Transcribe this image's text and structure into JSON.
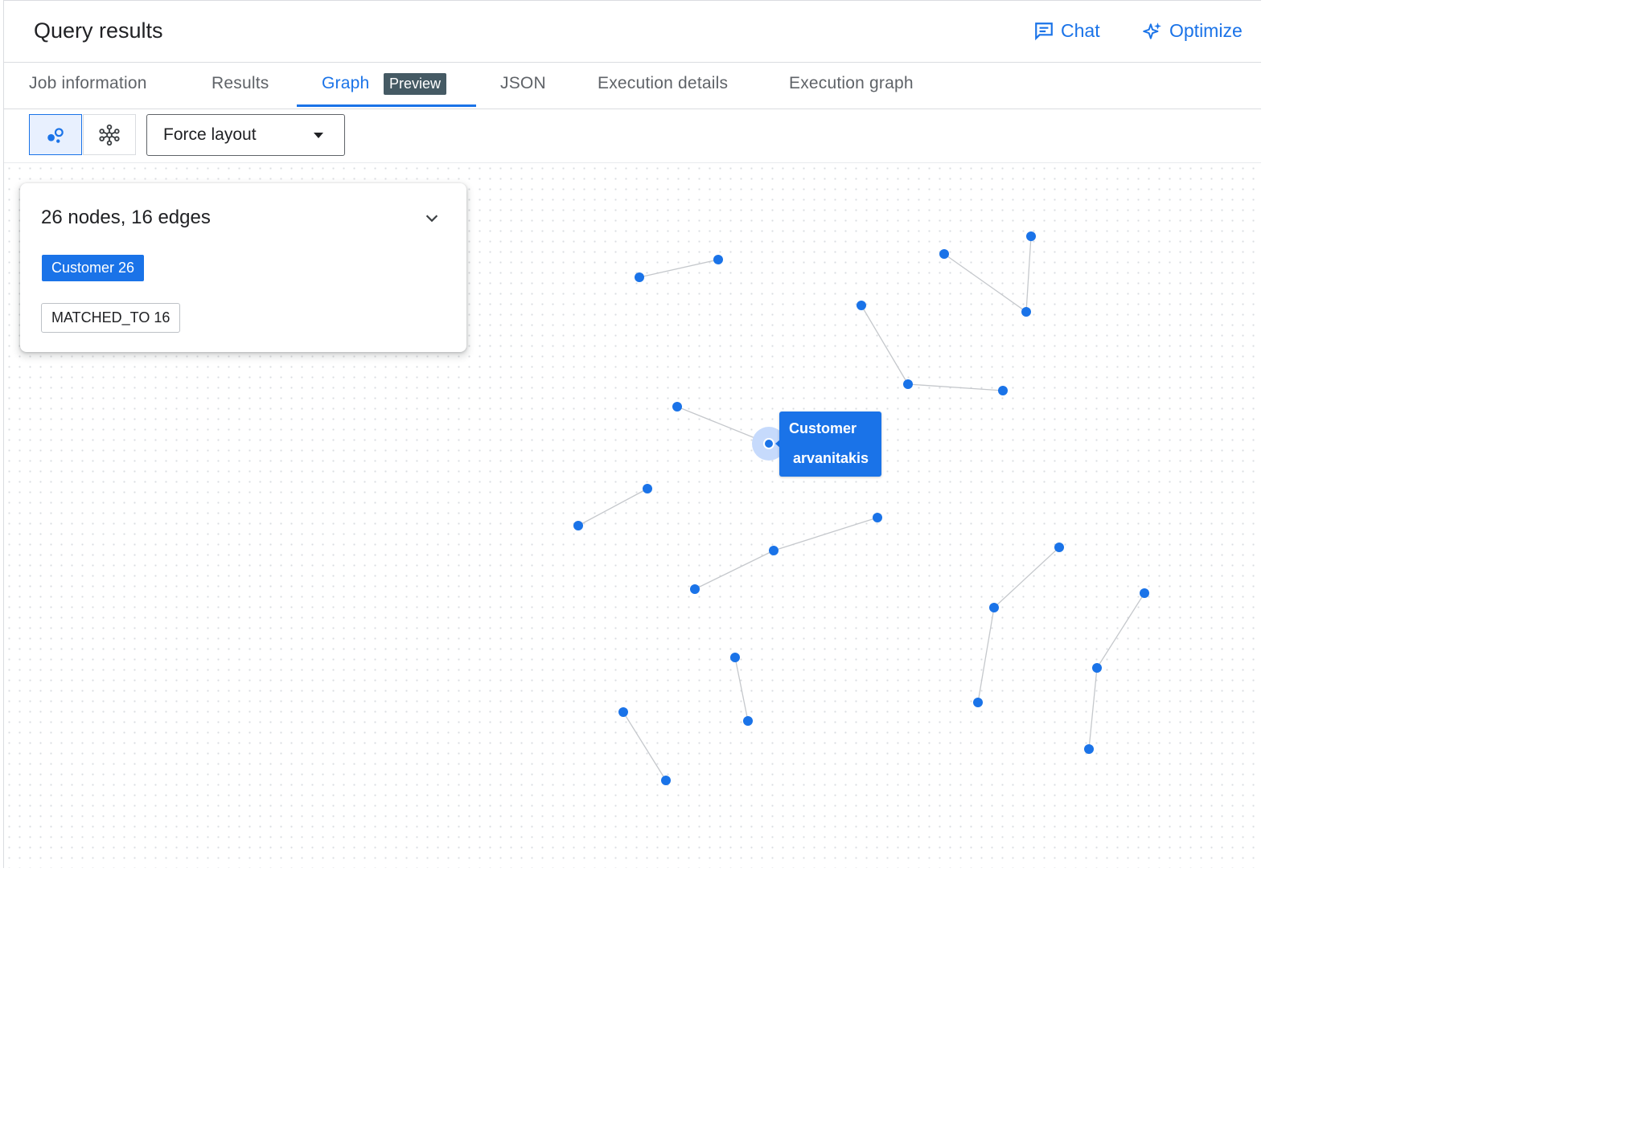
{
  "header": {
    "title": "Query results",
    "chat_label": "Chat",
    "optimize_label": "Optimize",
    "accent": "#1a73e8"
  },
  "tabs": [
    {
      "label": "Job information"
    },
    {
      "label": "Results"
    },
    {
      "label": "Graph",
      "badge": "Preview",
      "active": true
    },
    {
      "label": "JSON"
    },
    {
      "label": "Execution details"
    },
    {
      "label": "Execution graph"
    }
  ],
  "toolbar": {
    "view_modes": [
      "nodes-icon",
      "network-icon"
    ],
    "layout_select": "Force layout"
  },
  "summary": {
    "text": "26 nodes, 16 edges",
    "node_chip": "Customer 26",
    "edge_chip": "MATCHED_TO 16"
  },
  "tooltip": {
    "line1": "Customer",
    "line2": "arvanitakis"
  },
  "graph": {
    "node_color": "#1a73e8",
    "edge_color": "#c5c8cc"
  }
}
